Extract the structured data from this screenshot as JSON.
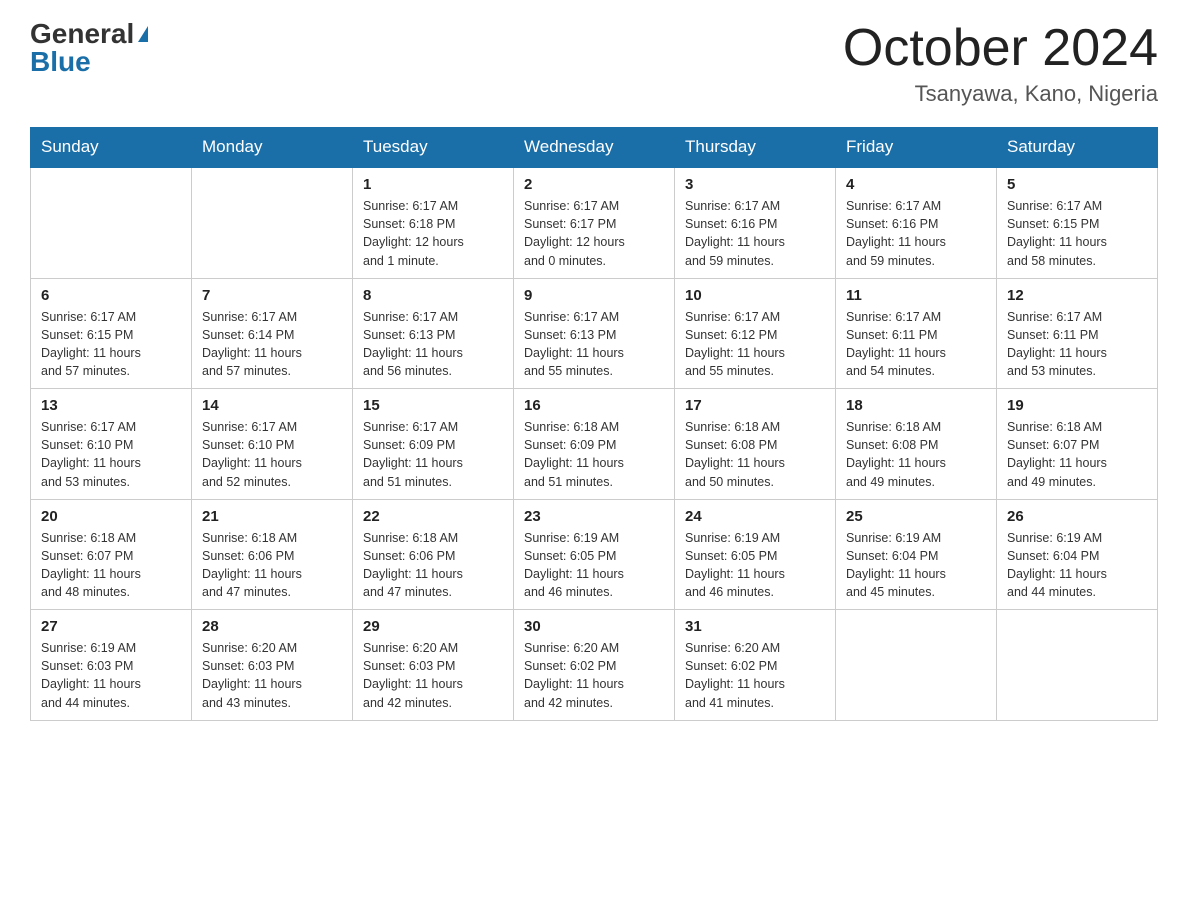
{
  "header": {
    "logo_general": "General",
    "logo_blue": "Blue",
    "month_year": "October 2024",
    "location": "Tsanyawa, Kano, Nigeria"
  },
  "days_of_week": [
    "Sunday",
    "Monday",
    "Tuesday",
    "Wednesday",
    "Thursday",
    "Friday",
    "Saturday"
  ],
  "weeks": [
    [
      {
        "day": "",
        "info": ""
      },
      {
        "day": "",
        "info": ""
      },
      {
        "day": "1",
        "info": "Sunrise: 6:17 AM\nSunset: 6:18 PM\nDaylight: 12 hours\nand 1 minute."
      },
      {
        "day": "2",
        "info": "Sunrise: 6:17 AM\nSunset: 6:17 PM\nDaylight: 12 hours\nand 0 minutes."
      },
      {
        "day": "3",
        "info": "Sunrise: 6:17 AM\nSunset: 6:16 PM\nDaylight: 11 hours\nand 59 minutes."
      },
      {
        "day": "4",
        "info": "Sunrise: 6:17 AM\nSunset: 6:16 PM\nDaylight: 11 hours\nand 59 minutes."
      },
      {
        "day": "5",
        "info": "Sunrise: 6:17 AM\nSunset: 6:15 PM\nDaylight: 11 hours\nand 58 minutes."
      }
    ],
    [
      {
        "day": "6",
        "info": "Sunrise: 6:17 AM\nSunset: 6:15 PM\nDaylight: 11 hours\nand 57 minutes."
      },
      {
        "day": "7",
        "info": "Sunrise: 6:17 AM\nSunset: 6:14 PM\nDaylight: 11 hours\nand 57 minutes."
      },
      {
        "day": "8",
        "info": "Sunrise: 6:17 AM\nSunset: 6:13 PM\nDaylight: 11 hours\nand 56 minutes."
      },
      {
        "day": "9",
        "info": "Sunrise: 6:17 AM\nSunset: 6:13 PM\nDaylight: 11 hours\nand 55 minutes."
      },
      {
        "day": "10",
        "info": "Sunrise: 6:17 AM\nSunset: 6:12 PM\nDaylight: 11 hours\nand 55 minutes."
      },
      {
        "day": "11",
        "info": "Sunrise: 6:17 AM\nSunset: 6:11 PM\nDaylight: 11 hours\nand 54 minutes."
      },
      {
        "day": "12",
        "info": "Sunrise: 6:17 AM\nSunset: 6:11 PM\nDaylight: 11 hours\nand 53 minutes."
      }
    ],
    [
      {
        "day": "13",
        "info": "Sunrise: 6:17 AM\nSunset: 6:10 PM\nDaylight: 11 hours\nand 53 minutes."
      },
      {
        "day": "14",
        "info": "Sunrise: 6:17 AM\nSunset: 6:10 PM\nDaylight: 11 hours\nand 52 minutes."
      },
      {
        "day": "15",
        "info": "Sunrise: 6:17 AM\nSunset: 6:09 PM\nDaylight: 11 hours\nand 51 minutes."
      },
      {
        "day": "16",
        "info": "Sunrise: 6:18 AM\nSunset: 6:09 PM\nDaylight: 11 hours\nand 51 minutes."
      },
      {
        "day": "17",
        "info": "Sunrise: 6:18 AM\nSunset: 6:08 PM\nDaylight: 11 hours\nand 50 minutes."
      },
      {
        "day": "18",
        "info": "Sunrise: 6:18 AM\nSunset: 6:08 PM\nDaylight: 11 hours\nand 49 minutes."
      },
      {
        "day": "19",
        "info": "Sunrise: 6:18 AM\nSunset: 6:07 PM\nDaylight: 11 hours\nand 49 minutes."
      }
    ],
    [
      {
        "day": "20",
        "info": "Sunrise: 6:18 AM\nSunset: 6:07 PM\nDaylight: 11 hours\nand 48 minutes."
      },
      {
        "day": "21",
        "info": "Sunrise: 6:18 AM\nSunset: 6:06 PM\nDaylight: 11 hours\nand 47 minutes."
      },
      {
        "day": "22",
        "info": "Sunrise: 6:18 AM\nSunset: 6:06 PM\nDaylight: 11 hours\nand 47 minutes."
      },
      {
        "day": "23",
        "info": "Sunrise: 6:19 AM\nSunset: 6:05 PM\nDaylight: 11 hours\nand 46 minutes."
      },
      {
        "day": "24",
        "info": "Sunrise: 6:19 AM\nSunset: 6:05 PM\nDaylight: 11 hours\nand 46 minutes."
      },
      {
        "day": "25",
        "info": "Sunrise: 6:19 AM\nSunset: 6:04 PM\nDaylight: 11 hours\nand 45 minutes."
      },
      {
        "day": "26",
        "info": "Sunrise: 6:19 AM\nSunset: 6:04 PM\nDaylight: 11 hours\nand 44 minutes."
      }
    ],
    [
      {
        "day": "27",
        "info": "Sunrise: 6:19 AM\nSunset: 6:03 PM\nDaylight: 11 hours\nand 44 minutes."
      },
      {
        "day": "28",
        "info": "Sunrise: 6:20 AM\nSunset: 6:03 PM\nDaylight: 11 hours\nand 43 minutes."
      },
      {
        "day": "29",
        "info": "Sunrise: 6:20 AM\nSunset: 6:03 PM\nDaylight: 11 hours\nand 42 minutes."
      },
      {
        "day": "30",
        "info": "Sunrise: 6:20 AM\nSunset: 6:02 PM\nDaylight: 11 hours\nand 42 minutes."
      },
      {
        "day": "31",
        "info": "Sunrise: 6:20 AM\nSunset: 6:02 PM\nDaylight: 11 hours\nand 41 minutes."
      },
      {
        "day": "",
        "info": ""
      },
      {
        "day": "",
        "info": ""
      }
    ]
  ]
}
